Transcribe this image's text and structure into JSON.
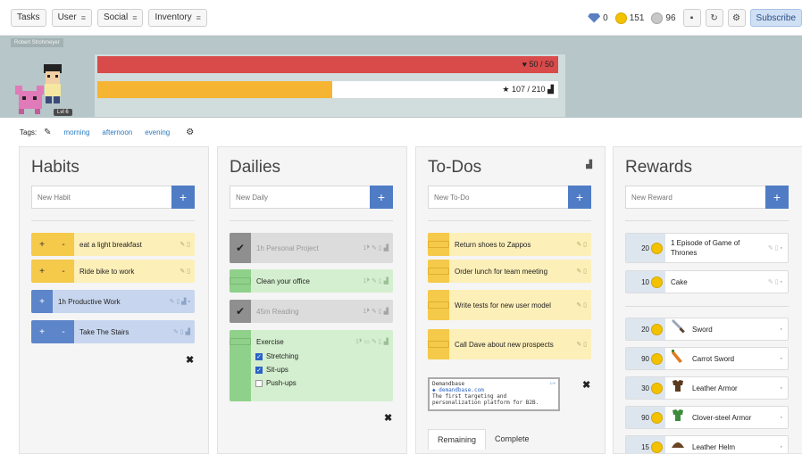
{
  "nav": {
    "tasks": "Tasks",
    "user": "User",
    "social": "Social",
    "inventory": "Inventory",
    "gems": "0",
    "gold": "151",
    "silver": "96",
    "subscribe": "Subscribe"
  },
  "header": {
    "user_name": "Robert Strohmeyer",
    "level": "Lvl 6",
    "hp_label": "50 / 50",
    "hp_fraction": 1.0,
    "xp_label": "107 / 210",
    "xp_fraction": 0.51,
    "colors": {
      "hp": "#d94a4a",
      "xp": "#f5b533",
      "header_bg": "#b7c6c8"
    }
  },
  "tags": {
    "label": "Tags:",
    "items": [
      "morning",
      "afternoon",
      "evening"
    ]
  },
  "habits": {
    "title": "Habits",
    "placeholder": "New Habit",
    "items": [
      {
        "text": "eat a light breakfast",
        "plus": "+",
        "minus": "-"
      },
      {
        "text": "Ride bike to work",
        "plus": "+",
        "minus": "-"
      },
      {
        "text": "1h Productive Work",
        "plus": "+"
      },
      {
        "text": "Take The Stairs",
        "plus": "+",
        "minus": "-"
      }
    ]
  },
  "dailies": {
    "title": "Dailies",
    "placeholder": "New Daily",
    "items": [
      {
        "text": "1h Personal Project",
        "streak": "1"
      },
      {
        "text": "Clean your office",
        "streak": "1"
      },
      {
        "text": "45m Reading",
        "streak": "1"
      },
      {
        "text": "Exercise",
        "streak": "1"
      }
    ],
    "checklist": [
      {
        "text": "Stretching",
        "checked": true
      },
      {
        "text": "Sit-ups",
        "checked": true
      },
      {
        "text": "Push-ups",
        "checked": false
      }
    ]
  },
  "todos": {
    "title": "To-Dos",
    "placeholder": "New To-Do",
    "items": [
      {
        "text": "Return shoes to Zappos"
      },
      {
        "text": "Order lunch for team meeting"
      },
      {
        "text": "Write tests for new user model"
      },
      {
        "text": "Call Dave about new prospects"
      }
    ],
    "ad": {
      "title": "Demandbase",
      "url": "demandbase.com",
      "body": "The first targeting and personalization platform for B2B."
    },
    "tabs": [
      "Remaining",
      "Complete"
    ]
  },
  "rewards": {
    "title": "Rewards",
    "placeholder": "New Reward",
    "custom": [
      {
        "price": "20",
        "text": "1 Episode of Game of Thrones"
      },
      {
        "price": "10",
        "text": "Cake"
      }
    ],
    "items": [
      {
        "price": "20",
        "text": "Sword",
        "icon": "sword-icon"
      },
      {
        "price": "90",
        "text": "Carrot Sword",
        "icon": "carrot-sword-icon"
      },
      {
        "price": "30",
        "text": "Leather Armor",
        "icon": "leather-armor-icon"
      },
      {
        "price": "90",
        "text": "Clover-steel Armor",
        "icon": "clover-armor-icon"
      },
      {
        "price": "15",
        "text": "Leather Helm",
        "icon": "leather-helm-icon"
      }
    ]
  }
}
